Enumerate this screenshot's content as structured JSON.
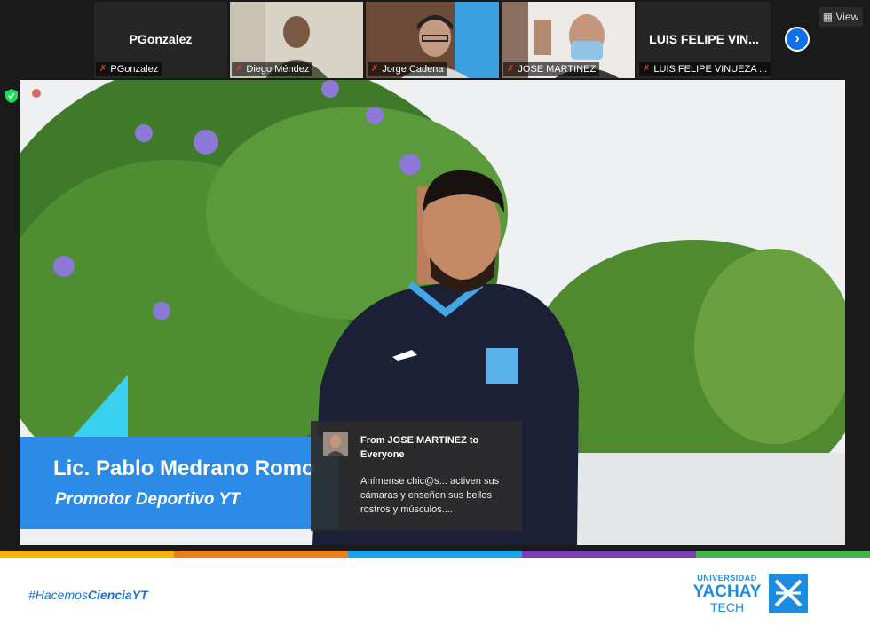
{
  "participants": [
    {
      "name": "PGonzalez",
      "big_name": "PGonzalez",
      "video": false
    },
    {
      "name": "Diego Méndez",
      "video": true
    },
    {
      "name": "Jorge Cadena",
      "video": true
    },
    {
      "name": "JOSE MARTINEZ",
      "video": true
    },
    {
      "name": "LUIS FELIPE VINUEZA ...",
      "big_name": "LUIS FELIPE VIN...",
      "video": false
    }
  ],
  "view_button": "View",
  "next_icon": "chevron-right-icon",
  "lower_third": {
    "name": "Lic. Pablo Medrano Romo",
    "role": "Promotor Deportivo YT"
  },
  "chat": {
    "from": "From JOSE MARTINEZ to Everyone",
    "message": "Anímense chic@s... activen sus cámaras y enseñen sus bellos rostros y músculos...."
  },
  "footer": {
    "hashtag_prefix": "#Hacemos",
    "hashtag_bold": "CienciaYT",
    "logo_line1": "UNIVERSIDAD",
    "logo_line2": "YACHAY",
    "logo_line3": "TECH"
  },
  "colors": {
    "bar": [
      "#f5b400",
      "#ef7d1a",
      "#1aa3e8",
      "#7a3fb0",
      "#4caf50"
    ],
    "brand": "#1d8ce0",
    "accent": "#2b8be6"
  }
}
